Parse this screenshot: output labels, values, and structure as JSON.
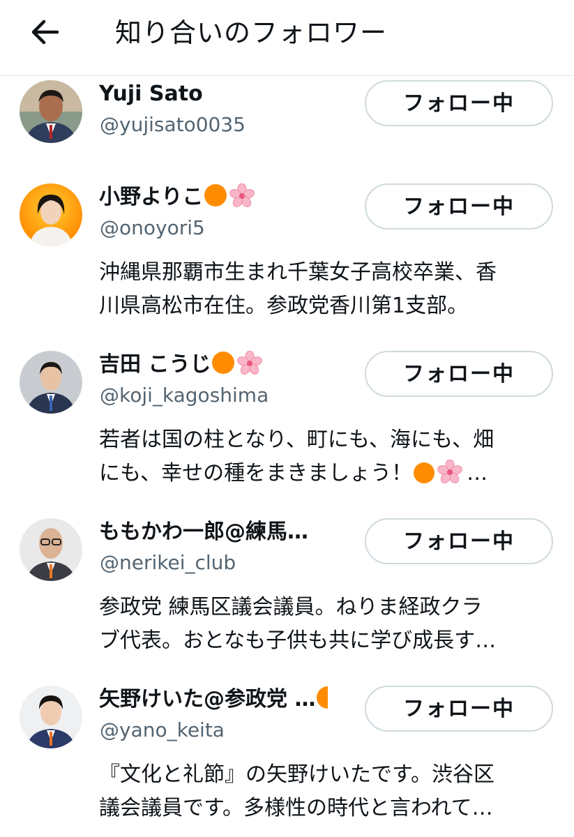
{
  "header": {
    "title": "知り合いのフォロワー",
    "back_icon": "arrow-left-icon"
  },
  "follow_button_label": "フォロー中",
  "users": [
    {
      "name": "Yuji Sato",
      "handle": "@yujisato0035",
      "bio": [],
      "emojis": []
    },
    {
      "name": "小野よりこ",
      "handle": "@onoyori5",
      "bio": [
        "沖縄県那覇市生まれ千葉女子高校卒業、香",
        "川県高松市在住。参政党香川第1支部。"
      ],
      "emojis": [
        "orange-circle",
        "cherry-blossom"
      ]
    },
    {
      "name": "吉田 こうじ",
      "handle": "@koji_kagoshima",
      "bio": [
        "若者は国の柱となり、町にも、海にも、畑",
        "にも、幸せの種をまきましょう！"
      ],
      "bio_tail": "…",
      "emojis": [
        "orange-circle",
        "cherry-blossom"
      ]
    },
    {
      "name": "ももかわ一郎@練馬…",
      "handle": "@nerikei_club",
      "bio": [
        "参政党 練馬区議会議員。ねりま経政クラ",
        "ブ代表。おとなも子供も共に学び成長す…"
      ],
      "emojis": []
    },
    {
      "name": "矢野けいた@参政党 …",
      "handle": "@yano_keita",
      "bio": [
        "『文化と礼節』の矢野けいたです。渋谷区",
        "議会議員です。多様性の時代と言われて…"
      ],
      "emojis": [
        "orange-circle"
      ]
    }
  ],
  "colors": {
    "text": "#0f1419",
    "secondary": "#536471",
    "border": "#cfd9de",
    "divider": "#e3e6e8",
    "accent_orange": "#ff8c00"
  }
}
